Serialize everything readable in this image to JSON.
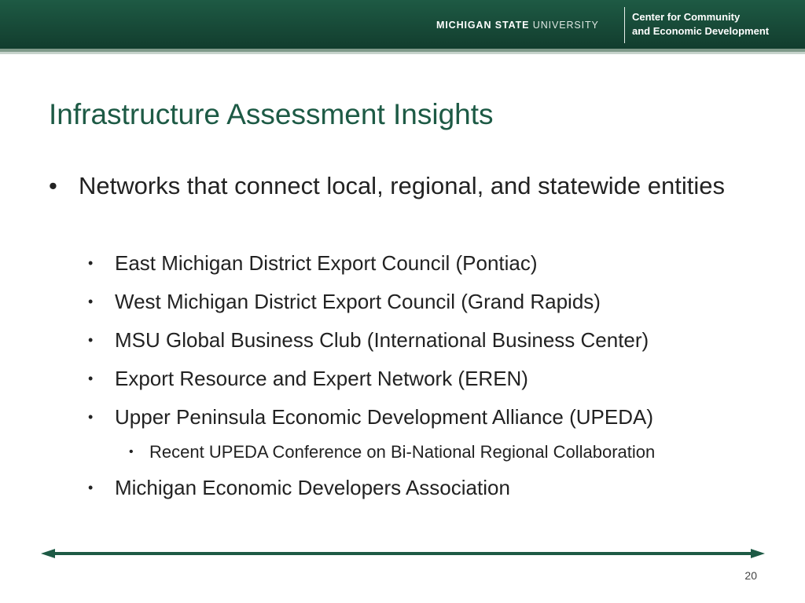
{
  "header": {
    "university_bold": "MICHIGAN STATE",
    "university_light": "UNIVERSITY",
    "center_line1": "Center for Community",
    "center_line2": "and Economic Development"
  },
  "slide": {
    "title": "Infrastructure Assessment Insights",
    "bullet_char": "•",
    "bullet": "Networks that connect local, regional, and statewide entities",
    "sub_items": [
      "East Michigan District Export Council (Pontiac)",
      "West Michigan District Export Council (Grand Rapids)",
      "MSU Global Business Club (International Business Center)",
      "Export Resource and Expert Network (EREN)",
      "Upper Peninsula Economic Development Alliance (UPEDA)",
      "Michigan Economic Developers Association"
    ],
    "sub_sub_item": "Recent UPEDA Conference on Bi-National Regional Collaboration",
    "page_number": "20"
  },
  "colors": {
    "header_green": "#1e5a44",
    "title_green": "#1d5a45"
  }
}
